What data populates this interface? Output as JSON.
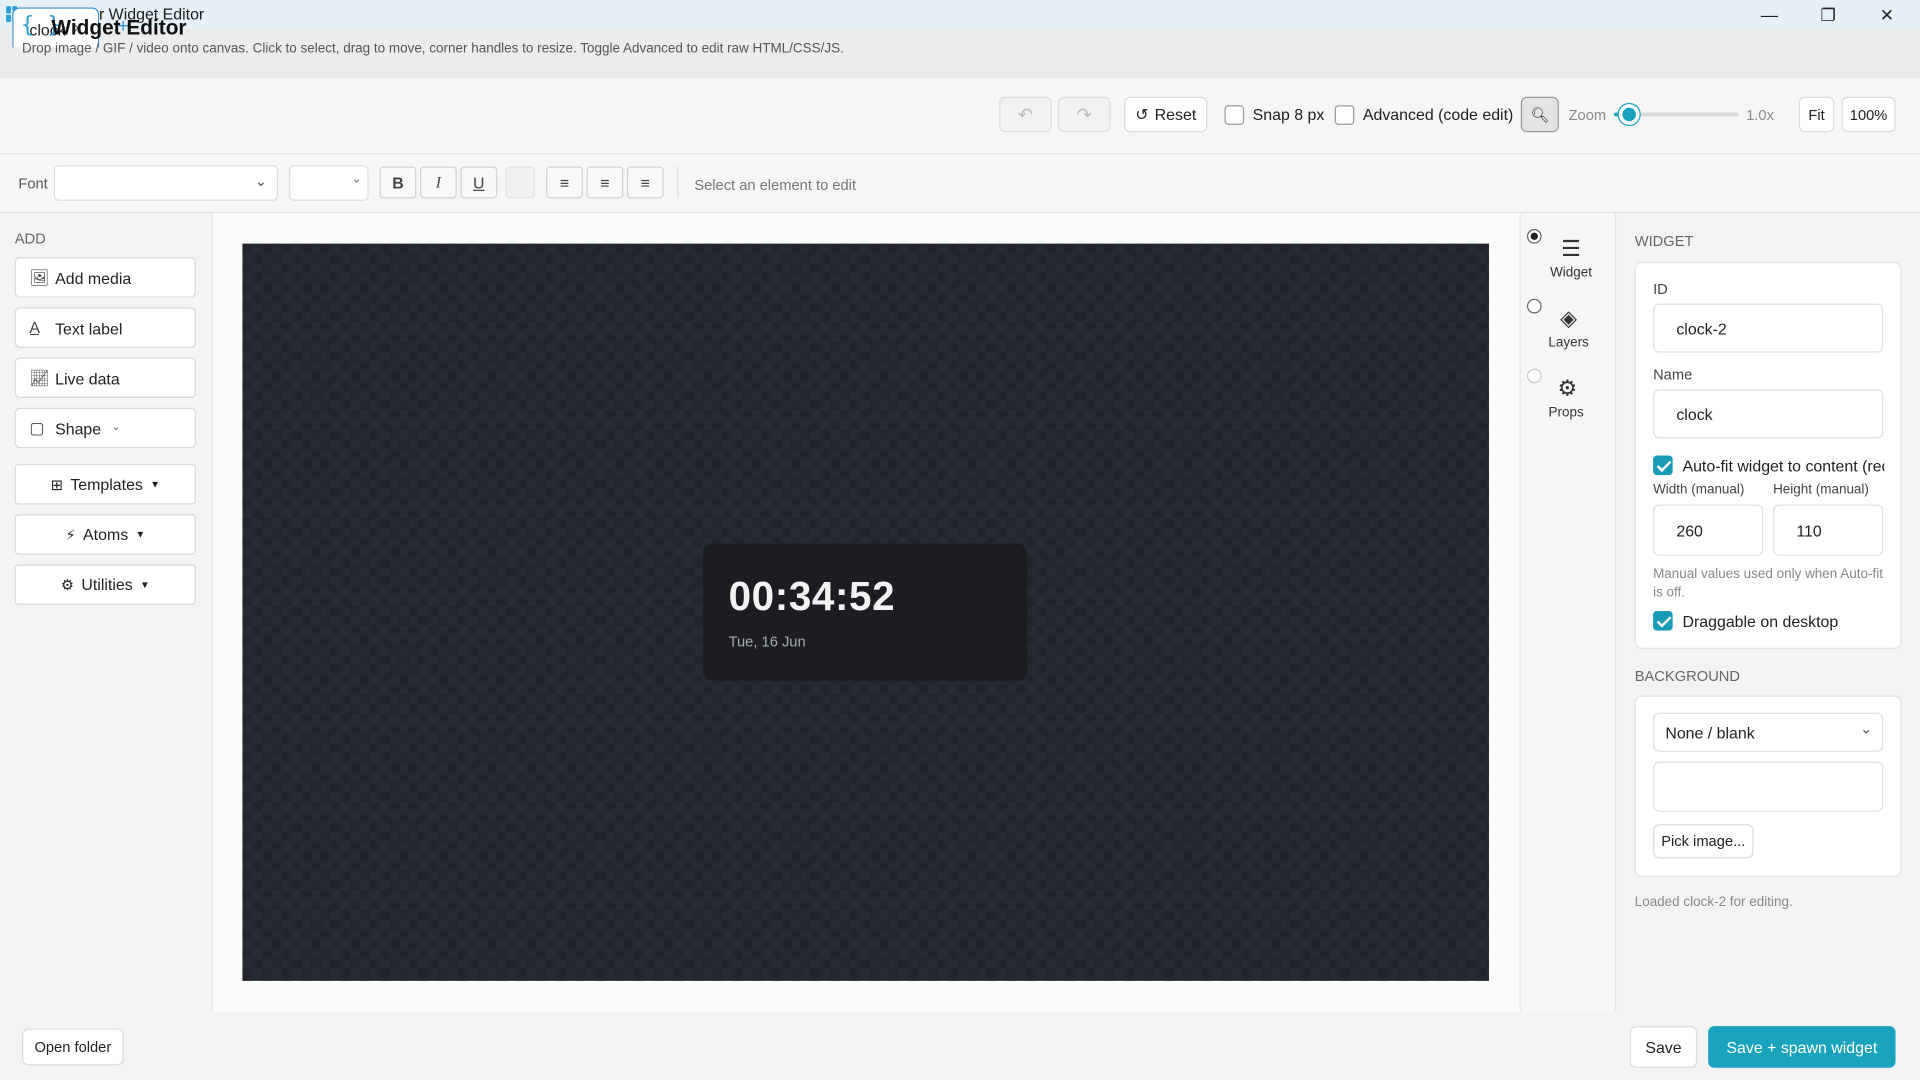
{
  "window": {
    "title": "DeskLayer Widget Editor",
    "minimize": "—",
    "restore": "❐",
    "close": "✕"
  },
  "tabs": [
    {
      "label": "clock",
      "close": "×"
    }
  ],
  "tab_add": "+",
  "header": {
    "title": "Widget Editor",
    "subtitle": "Drop image / GIF / video onto canvas. Click to select, drag to move, corner handles to resize. Toggle Advanced to edit raw HTML/CSS/JS.",
    "reset_label": "Reset",
    "snap_label": "Snap 8 px",
    "advanced_label": "Advanced (code edit)",
    "zoom_label": "Zoom",
    "zoom_value": "1.0x",
    "zoom_level": 0.12,
    "fit_label": "Fit",
    "hundred_label": "100%"
  },
  "fontbar": {
    "font_label": "Font",
    "font_value": "",
    "size_value": "",
    "bold": "B",
    "italic": "I",
    "underline": "U",
    "hint": "Select an element to edit"
  },
  "sidebar": {
    "heading": "ADD",
    "add_items": [
      {
        "label": "Add media",
        "icon": "image-icon"
      },
      {
        "label": "Text label",
        "icon": "text-icon"
      },
      {
        "label": "Live data",
        "icon": "chart-icon"
      },
      {
        "label": "Shape",
        "icon": "square-icon"
      }
    ],
    "menus": [
      {
        "label": "Templates",
        "icon": "grid-icon"
      },
      {
        "label": "Atoms",
        "icon": "atom-icon"
      },
      {
        "label": "Utilities",
        "icon": "gear-icon"
      }
    ]
  },
  "canvas": {
    "time": "00:34:52",
    "date": "Tue, 16 Jun"
  },
  "rightnav": [
    {
      "label": "Widget",
      "icon": "list-icon",
      "selected": true
    },
    {
      "label": "Layers",
      "icon": "layers-icon",
      "selected": false
    },
    {
      "label": "Props",
      "icon": "gear-icon",
      "selected": false
    }
  ],
  "widget_panel": {
    "heading": "WIDGET",
    "id_label": "ID",
    "id_value": "clock-2",
    "name_label": "Name",
    "name_value": "clock",
    "autofit_label": "Auto-fit widget to content (rec",
    "width_label": "Width (manual)",
    "width_value": "260",
    "height_label": "Height (manual)",
    "height_value": "110",
    "manual_note": "Manual values used only when Auto-fit is off.",
    "draggable_label": "Draggable on desktop"
  },
  "background_panel": {
    "heading": "BACKGROUND",
    "select_value": "None / blank",
    "pick_image_label": "Pick image...",
    "status": "Loaded clock-2 for editing."
  },
  "footer": {
    "open_folder": "Open folder",
    "save": "Save",
    "save_spawn": "Save + spawn widget"
  },
  "colors": {
    "accent": "#1aa3bd",
    "canvas_bg": "#22252b",
    "widget_bg": "#1b1d22"
  }
}
